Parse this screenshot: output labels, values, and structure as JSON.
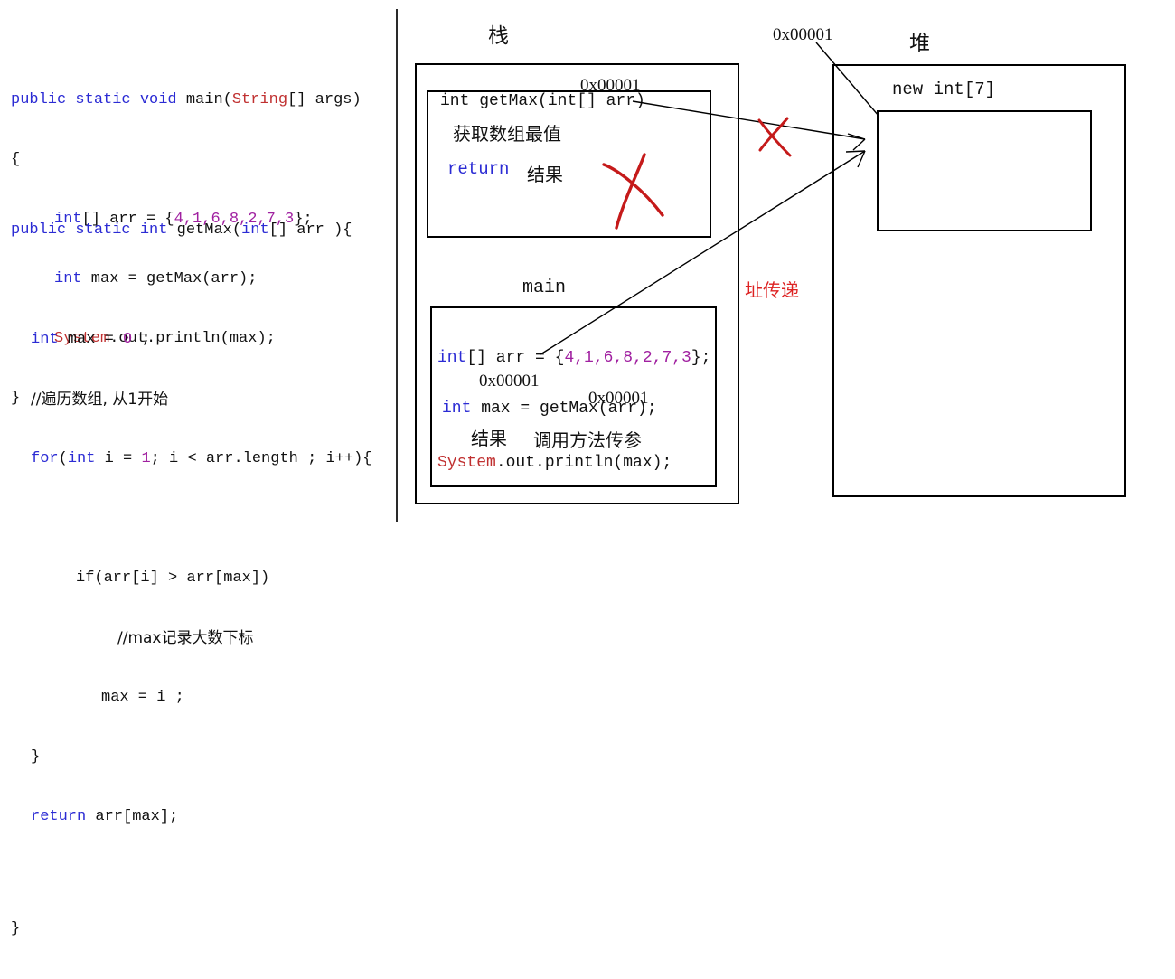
{
  "code_panel": {
    "main_method": {
      "signature_kw": "public static void ",
      "signature_name": "main(",
      "signature_param_type": "String",
      "signature_param_rest": "[] args)",
      "open_brace": "{",
      "line_arr_type": "int",
      "line_arr_mid": "[] arr = {",
      "line_arr_values": "4,1,6,8,2,7,3",
      "line_arr_end": "};",
      "line_max_type": "int",
      "line_max_rest": " max = getMax(arr);",
      "line_print_cls": "System",
      "line_print_rest": ".out.println(max);",
      "close_brace": "}"
    },
    "getmax_method": {
      "signature_kw": "public static ",
      "signature_ret": "int",
      "signature_name": " getMax(",
      "signature_param_type": "int",
      "signature_param_rest": "[] arr ){",
      "line_max_type": "int",
      "line_max_mid": " max = ",
      "line_max_zero": "0",
      "line_max_end": " ;",
      "comment_loop": "//遍历数组, 从1开始",
      "for_kw": "for",
      "for_open": "(",
      "for_type": "int",
      "for_mid": " i = ",
      "for_one": "1",
      "for_rest": "; i < arr.length ; i++){",
      "if_line": "if(arr[i] > arr[max])",
      "comment_max": "//max记录大数下标",
      "assign_line": "max = i ;",
      "inner_close": "}",
      "return_kw": "return",
      "return_rest": " arr[max];",
      "close_brace": "}"
    }
  },
  "stack": {
    "title": "栈",
    "getmax_frame": {
      "address_label": "0x00001",
      "signature": "int getMax(int[] arr)",
      "description": "获取数组最值",
      "return_kw": "return",
      "return_value": "结果"
    },
    "main_frame": {
      "title": "main",
      "arr_type": "int",
      "arr_mid": "[] arr = {",
      "arr_values": "4,1,6,8,2,7,3",
      "arr_end": "};",
      "arr_address": "0x00001",
      "max_type": "int",
      "max_rest": " max = getMax(arr);",
      "max_address": "0x00001",
      "result_label": "结果",
      "call_label": "调用方法传参",
      "print_cls": "System",
      "print_rest": ".out.println(max);"
    }
  },
  "heap": {
    "title": "堆",
    "address_label": "0x00001",
    "allocation": "new int[7]"
  },
  "annotations": {
    "pass_by_address": "址传递"
  },
  "colors": {
    "keyword_blue": "#2b2bd4",
    "class_red": "#c03030",
    "number_purple": "#a020a0",
    "comment_green": "#1f7a3d",
    "mark_red": "#d22",
    "line_black": "#000000"
  }
}
